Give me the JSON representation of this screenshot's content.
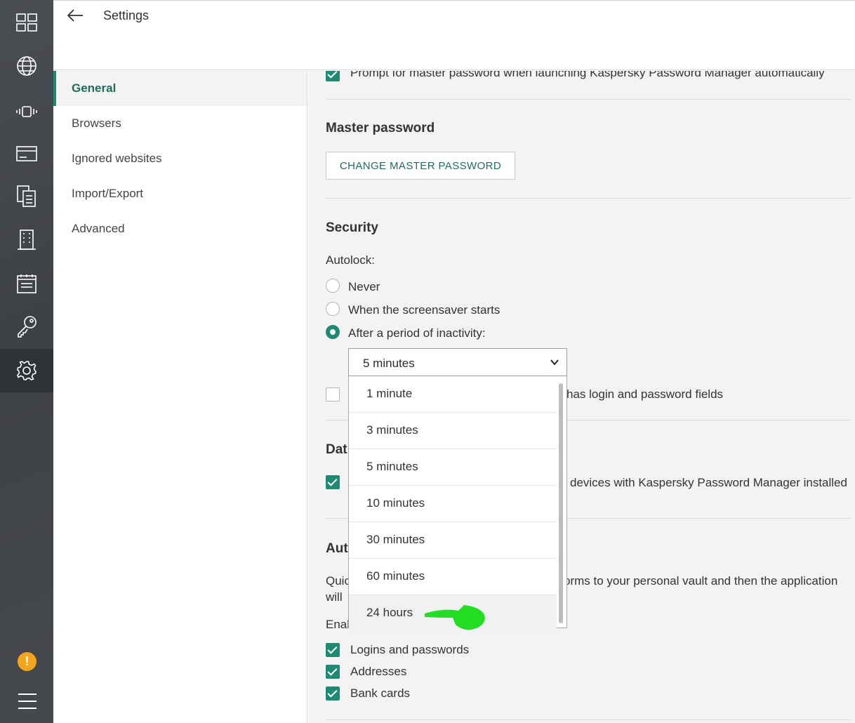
{
  "header": {
    "title": "Settings"
  },
  "rail": {
    "icons": [
      "dashboard-icon",
      "globe-icon",
      "vibrate-icon",
      "bank-card-icon",
      "documents-icon",
      "building-icon",
      "notes-icon",
      "key-icon",
      "settings-icon"
    ],
    "active": "settings-icon",
    "warning_glyph": "!"
  },
  "nav": {
    "items": [
      {
        "label": "General"
      },
      {
        "label": "Browsers"
      },
      {
        "label": "Ignored websites"
      },
      {
        "label": "Import/Export"
      },
      {
        "label": "Advanced"
      }
    ],
    "active_index": 0
  },
  "content": {
    "prompt_master_password": {
      "label": "Prompt for master password when launching Kaspersky Password Manager automatically",
      "checked": true
    },
    "master_password": {
      "heading": "Master password",
      "button": "CHANGE MASTER PASSWORD"
    },
    "security": {
      "heading": "Security",
      "autolock_label": "Autolock:",
      "options": [
        {
          "label": "Never",
          "selected": false
        },
        {
          "label": "When the screensaver starts",
          "selected": false
        },
        {
          "label": "After a period of inactivity:",
          "selected": true
        }
      ],
      "partial_label": "has login and password fields"
    },
    "data_section": {
      "heading_partial": "Dat",
      "sync_label_partial": "devices with Kaspersky Password Manager installed"
    },
    "autofill_section": {
      "heading_partial": "Aut",
      "desc_line1_start": "Quic",
      "desc_line1_end": "orms to your personal vault and then the application",
      "desc_line2_start": "will",
      "enable_label_partial": "Enab",
      "items": [
        {
          "label": "Logins and passwords",
          "checked": true
        },
        {
          "label": "Addresses",
          "checked": true
        },
        {
          "label": "Bank cards",
          "checked": true
        }
      ]
    }
  },
  "dropdown": {
    "value": "5 minutes",
    "options": [
      "1 minute",
      "3 minutes",
      "5 minutes",
      "10 minutes",
      "30 minutes",
      "60 minutes",
      "24 hours"
    ],
    "highlighted_index": 6
  },
  "colors": {
    "accent": "#1f8a74",
    "rail": "#43464b",
    "annotation": "#22dd22",
    "warning": "#f2a51a"
  }
}
